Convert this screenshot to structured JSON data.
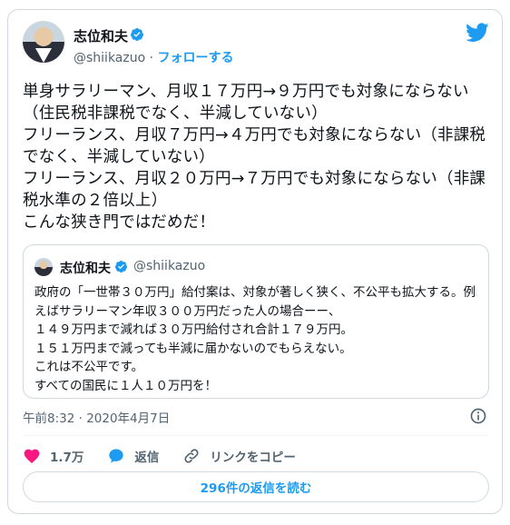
{
  "author": {
    "name": "志位和夫",
    "handle": "@shiikazuo",
    "separator": "·",
    "follow_label": "フォローする"
  },
  "tweet": {
    "text": "単身サラリーマン、月収１７万円→９万円でも対象にならない（住民税非課税でなく、半減していない）\nフリーランス、月収７万円→４万円でも対象にならない（非課税でなく、半減していない）\nフリーランス、月収２０万円→７万円でも対象にならない（非課税水準の２倍以上）\nこんな狭き門ではだめだ！",
    "timestamp": "午前8:32 · 2020年4月7日"
  },
  "quoted": {
    "name": "志位和夫",
    "handle": "@shiikazuo",
    "text": "政府の「一世帯３０万円」給付案は、対象が著しく狭く、不公平も拡大する。例えばサラリーマン年収３００万円だった人の場合ーー、\n１４９万円まで減れば３０万円給付され合計１７９万円。\n１５１万円まで減っても半減に届かないのでもらえない。\nこれは不公平です。\nすべての国民に１人１０万円を！"
  },
  "actions": {
    "likes": "1.7万",
    "reply_label": "返信",
    "copy_link_label": "リンクをコピー"
  },
  "read_replies_label": "296件の返信を読む",
  "colors": {
    "accent": "#1d9bf0",
    "like": "#f91880",
    "secondary_text": "#536471",
    "border": "#cfd9de"
  },
  "icons": [
    "verified-badge-icon",
    "twitter-bird-icon",
    "info-icon",
    "heart-icon",
    "reply-bubble-icon",
    "link-icon"
  ]
}
